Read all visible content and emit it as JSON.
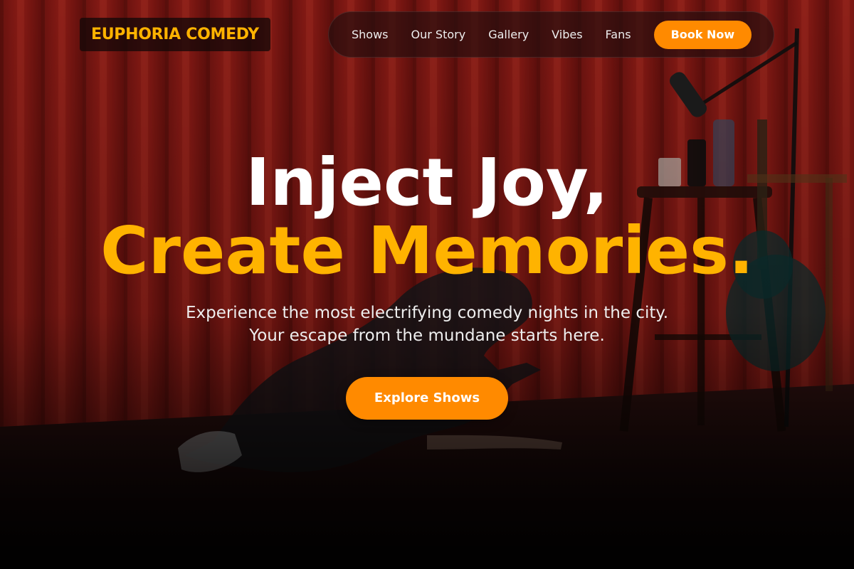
{
  "brand": {
    "name": "EUPHORIA COMEDY",
    "accent_color": "#ffb300",
    "button_color": "#ff8a00"
  },
  "nav": {
    "items": [
      "Shows",
      "Our Story",
      "Gallery",
      "Vibes",
      "Fans"
    ],
    "cta_label": "Book Now"
  },
  "hero": {
    "title_line1": "Inject Joy,",
    "title_line2": "Create Memories.",
    "subtitle": "Experience the most electrifying comedy nights in the city. Your escape from the mundane starts here.",
    "cta_label": "Explore Shows",
    "background_image": "comedian performing on stage in front of red curtain, microphone stand, stool with drinks, guitar"
  }
}
